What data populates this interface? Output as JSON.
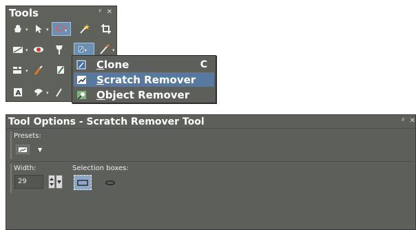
{
  "tools_palette": {
    "title": "Tools",
    "header_buttons": [
      "pin-icon",
      "close-icon"
    ],
    "tools": [
      {
        "name": "pan-icon",
        "has_dropdown": true
      },
      {
        "name": "pointer-icon",
        "has_dropdown": true
      },
      {
        "name": "lasso-selection-icon",
        "has_dropdown": true,
        "selected": true
      },
      {
        "name": "magic-wand-icon",
        "has_dropdown": false
      },
      {
        "name": "crop-icon",
        "has_dropdown": false
      },
      {
        "name": "straighten-icon",
        "has_dropdown": true
      },
      {
        "name": "red-eye-icon",
        "has_dropdown": false
      },
      {
        "name": "makeover-icon",
        "has_dropdown": false
      },
      {
        "name": "clone-brush-icon",
        "has_dropdown": true,
        "selected": true
      },
      {
        "name": "paint-brush-icon",
        "has_dropdown": true
      },
      {
        "name": "color-replacer-icon",
        "has_dropdown": true
      },
      {
        "name": "dropper-icon",
        "has_dropdown": false
      },
      {
        "name": "lighten-darken-icon",
        "has_dropdown": false
      },
      {
        "name": "text-icon",
        "has_dropdown": false
      },
      {
        "name": "preset-shape-icon",
        "has_dropdown": true
      },
      {
        "name": "pen-icon",
        "has_dropdown": false
      }
    ]
  },
  "flyout_menu": {
    "items": [
      {
        "icon": "clone-brush-icon",
        "underline": "C",
        "rest": "lone",
        "shortcut": "C",
        "active": false
      },
      {
        "icon": "scratch-remover-icon",
        "underline": "S",
        "rest": "cratch Remover",
        "shortcut": "",
        "active": true
      },
      {
        "icon": "object-remover-icon",
        "underline": "O",
        "rest": "bject Remover",
        "shortcut": "",
        "active": false
      }
    ]
  },
  "tool_options": {
    "title": "Tool Options - Scratch Remover Tool",
    "header_buttons": [
      "pin-icon",
      "close-icon"
    ],
    "presets_label": "Presets:",
    "width_label": "Width:",
    "width_value": "29",
    "selection_boxes_label": "Selection boxes:"
  },
  "colors": {
    "panel_bg": "#5d5f5a",
    "highlight": "#57799f",
    "text": "#ffffff"
  }
}
